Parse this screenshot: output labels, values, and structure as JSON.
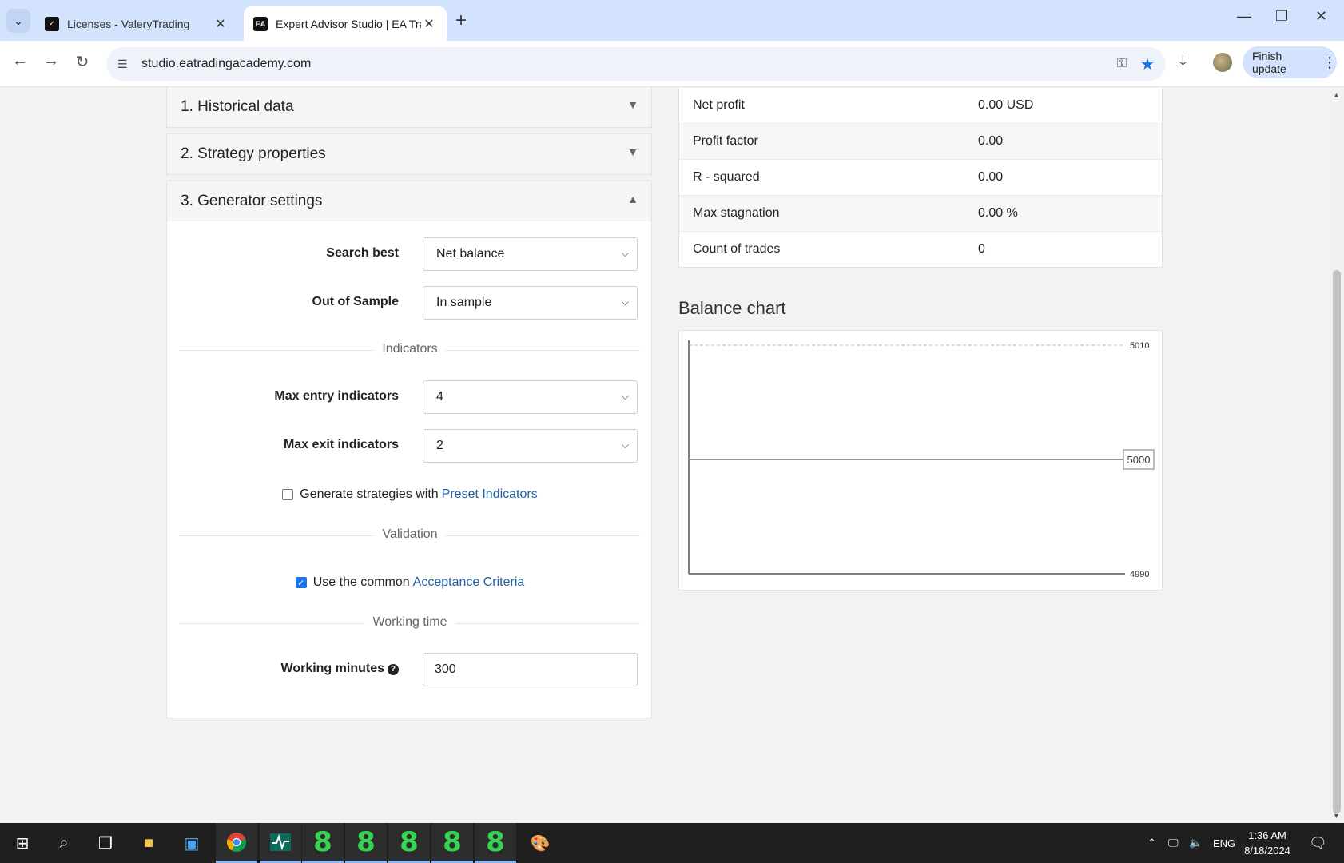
{
  "browser": {
    "tabs": [
      {
        "title": "Licenses - ValeryTrading",
        "favicon": "valery-icon"
      },
      {
        "title": "Expert Advisor Studio | EA Tradi",
        "favicon": "ea-icon"
      }
    ],
    "url": "studio.eatradingacademy.com",
    "finish_update": "Finish update"
  },
  "accordion": {
    "historical": "1. Historical data",
    "strategy": "2. Strategy properties",
    "generator": "3. Generator settings"
  },
  "generator": {
    "search_best": {
      "label": "Search best",
      "value": "Net balance"
    },
    "out_of_sample": {
      "label": "Out of Sample",
      "value": "In sample"
    },
    "indicators_heading": "Indicators",
    "max_entry": {
      "label": "Max entry indicators",
      "value": "4"
    },
    "max_exit": {
      "label": "Max exit indicators",
      "value": "2"
    },
    "preset": {
      "text": "Generate strategies with",
      "link": "Preset Indicators",
      "checked": false
    },
    "validation_heading": "Validation",
    "acceptance": {
      "text": "Use the common",
      "link": "Acceptance Criteria",
      "checked": true
    },
    "working_time_heading": "Working time",
    "working_minutes": {
      "label": "Working minutes",
      "value": "300"
    }
  },
  "stats": [
    {
      "key": "Net profit",
      "value": "0.00 USD"
    },
    {
      "key": "Profit factor",
      "value": "0.00"
    },
    {
      "key": "R - squared",
      "value": "0.00"
    },
    {
      "key": "Max stagnation",
      "value": "0.00 %"
    },
    {
      "key": "Count of trades",
      "value": "0"
    }
  ],
  "chart_title": "Balance chart",
  "chart_data": {
    "type": "line",
    "title": "Balance chart",
    "x": [
      0,
      1
    ],
    "series": [
      {
        "values": [
          5000,
          5000
        ]
      }
    ],
    "ylim": [
      4990,
      5010
    ],
    "yticks": [
      4990,
      5010
    ],
    "current_label": "5000",
    "grid": false
  },
  "taskbar": {
    "time": "1:36 AM",
    "date": "8/18/2024",
    "lang": "ENG",
    "eight_count_label": "8"
  },
  "colors": {
    "link": "#1f5fa6",
    "accent": "#1a73e8",
    "taskbar_green": "#39d353"
  }
}
